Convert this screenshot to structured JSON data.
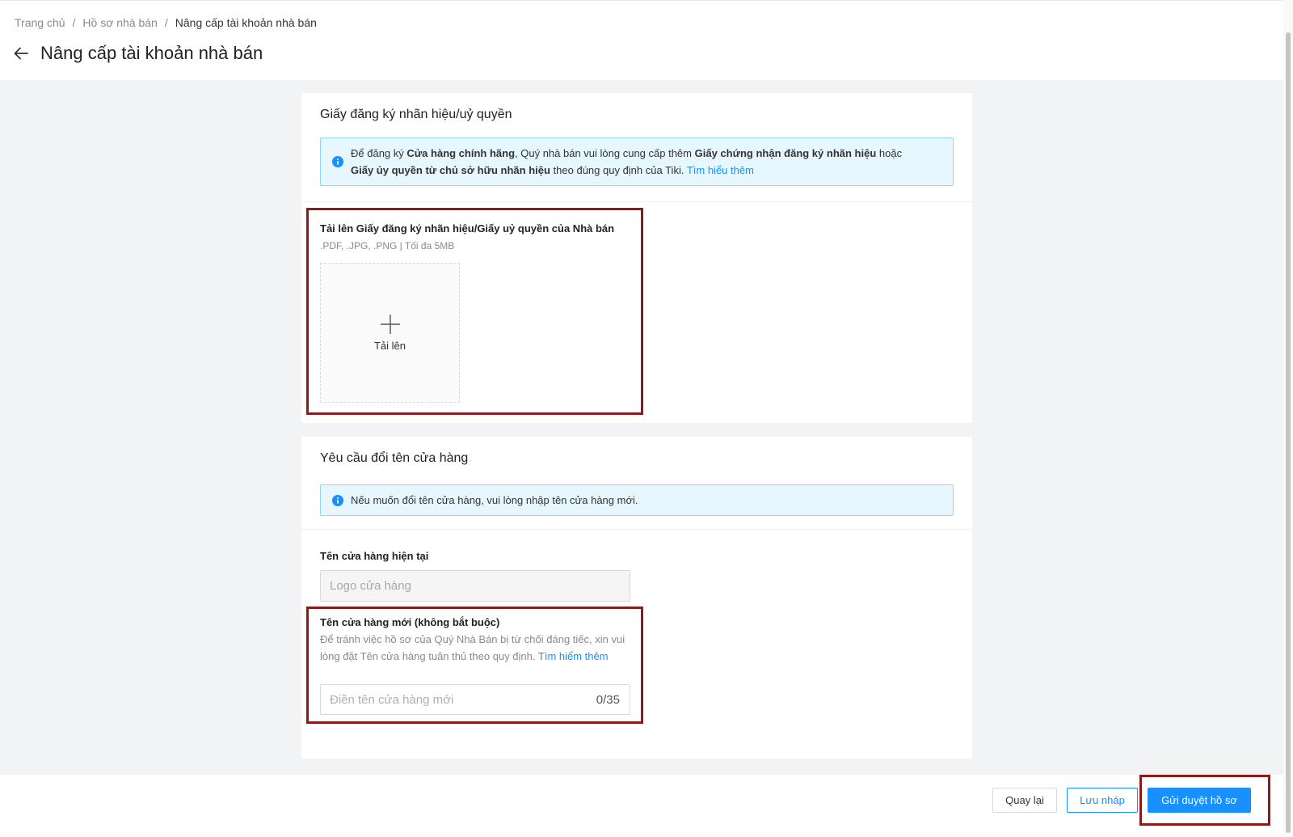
{
  "breadcrumb": {
    "items": [
      "Trang chủ",
      "Hồ sơ nhà bán"
    ],
    "current": "Nâng cấp tài khoản nhà bán",
    "separator": "/"
  },
  "page": {
    "title": "Nâng cấp tài khoản nhà bán"
  },
  "trademark_section": {
    "title": "Giấy đăng ký nhãn hiệu/uỷ quyền",
    "notice": {
      "p1": "Để đăng ký ",
      "b1": "Cửa hàng chính hãng",
      "p2": ", Quý nhà bán vui lòng cung cấp thêm ",
      "b2": "Giấy chứng nhận đăng ký nhãn hiệu",
      "p3": " hoặc",
      "b3": "Giấy ủy quyền từ chủ sở hữu nhãn hiệu",
      "p4": " theo đúng quy định của Tiki. ",
      "link": "Tìm hiểu thêm"
    },
    "upload_label": "Tải lên Giấy đăng ký nhãn hiệu/Giấy uỷ quyền của Nhà bán",
    "upload_hint": ".PDF, .JPG, .PNG | Tối đa 5MB",
    "upload_button": "Tải lên"
  },
  "rename_section": {
    "title": "Yêu cầu đổi tên cửa hàng",
    "notice": "Nếu muốn đổi tên cửa hàng, vui lòng nhập tên cửa hàng mới.",
    "current_name_label": "Tên cửa hàng hiện tại",
    "current_name_placeholder": "Logo cửa hàng",
    "new_name_label": "Tên cửa hàng mới (không bắt buộc)",
    "new_name_desc": "Để tránh việc hồ sơ của Quý Nhà Bán bị từ chối đáng tiếc, xin vui lòng đặt Tên cửa hàng tuân thủ theo quy định. ",
    "new_name_link": "Tìm hiểm thêm",
    "new_name_placeholder": "Điền tên cửa hàng mới",
    "new_name_counter": "0/35"
  },
  "footer": {
    "back_label": "Quay lại",
    "draft_label": "Lưu nháp",
    "submit_label": "Gửi duyệt hồ sơ"
  },
  "colors": {
    "accent": "#1890ff",
    "notice_bg": "#e6f7ff",
    "highlight": "#8b1a1a"
  },
  "icons": [
    "arrow-left-icon",
    "info-icon",
    "plus-icon"
  ]
}
